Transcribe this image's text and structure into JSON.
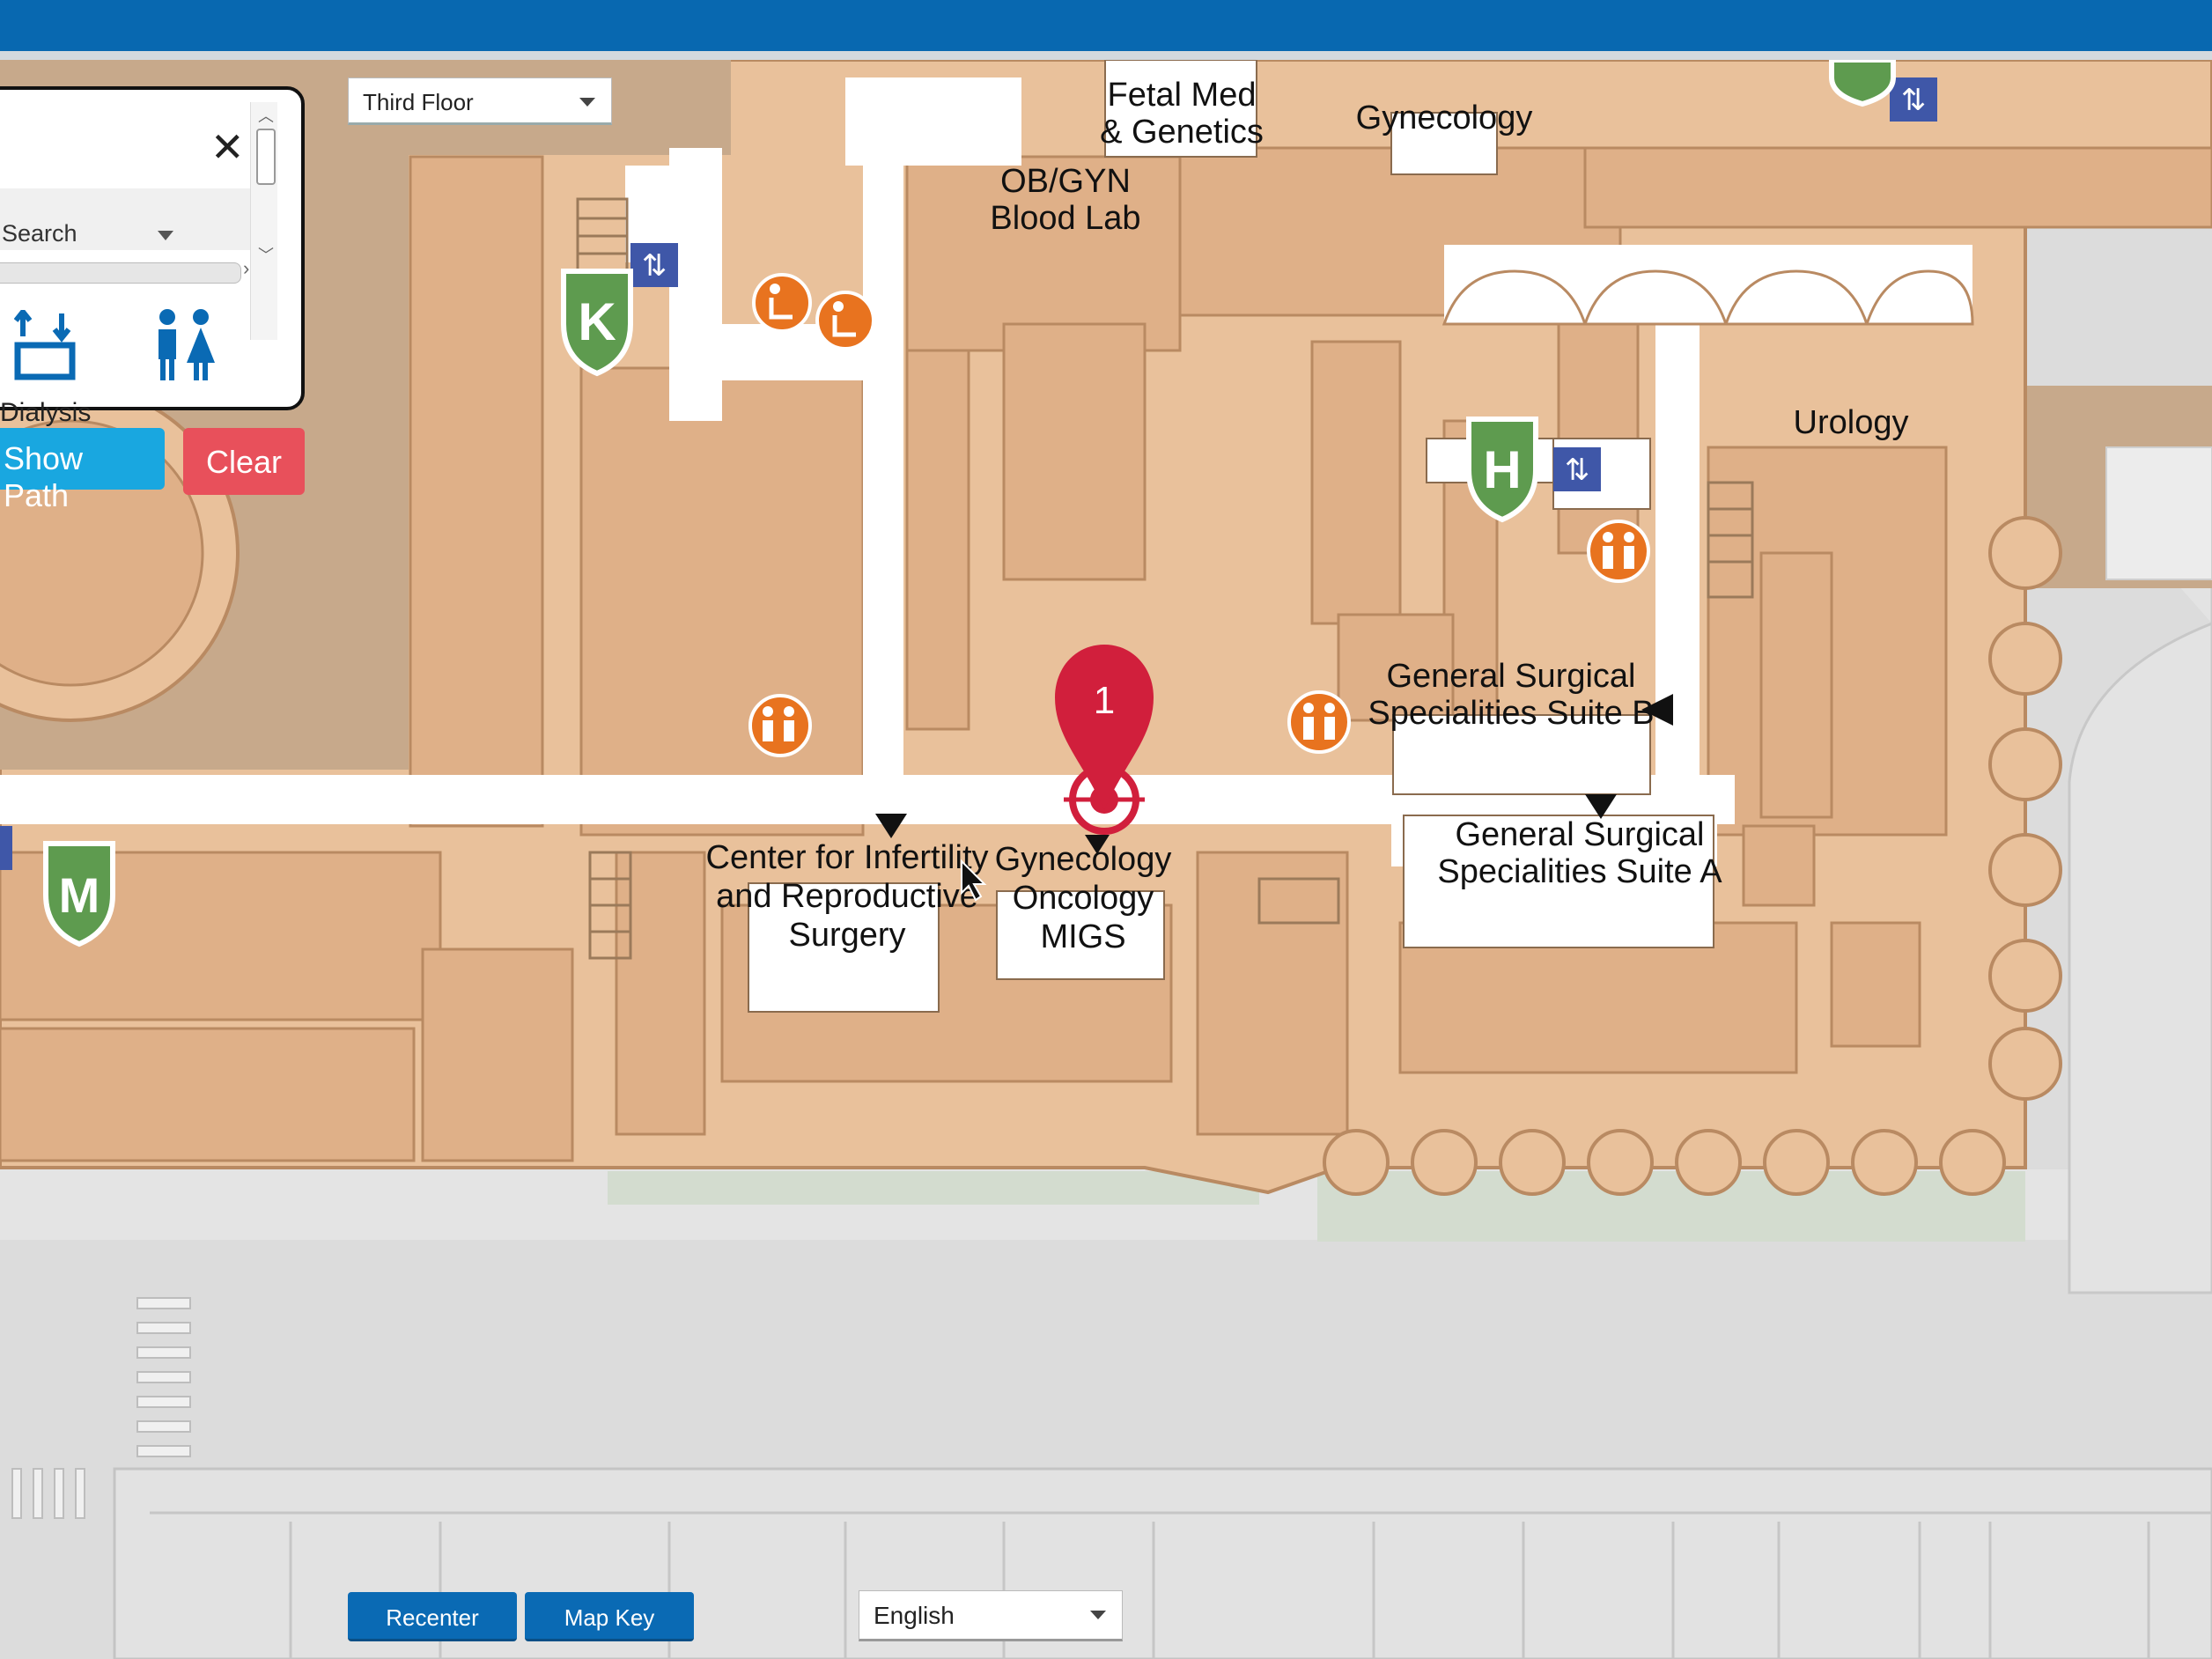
{
  "floor_select": {
    "value": "Third Floor"
  },
  "search_panel": {
    "search_label": "Search",
    "close_symbol": "✕",
    "partial_destination": "Dialysis"
  },
  "buttons": {
    "show_path": "Show Path",
    "clear": "Clear",
    "recenter": "Recenter",
    "map_key": "Map Key"
  },
  "language_select": {
    "value": "English"
  },
  "map": {
    "pin_number": "1",
    "elevator_glyph": "⇅",
    "labels": {
      "fetal_1": "Fetal Med",
      "fetal_2": "& Genetics",
      "gynecology": "Gynecology",
      "obgyn_1": "OB/GYN",
      "obgyn_2": "Blood Lab",
      "urology": "Urology",
      "gss_b_1": "General Surgical",
      "gss_b_2": "Specialities Suite B",
      "gss_a_1": "General Surgical",
      "gss_a_2": "Specialities Suite A",
      "infert_1": "Center for Infertility",
      "infert_2": "and Reproductive",
      "infert_3": "Surgery",
      "gyn_onc_1": "Gynecology",
      "gyn_onc_2": "Oncology",
      "gyn_onc_3": "MIGS"
    },
    "elevator_markers": [
      {
        "letter": "K"
      },
      {
        "letter": "H"
      },
      {
        "letter": "M"
      }
    ]
  },
  "colors": {
    "header": "#0868b0",
    "floor_fill": "#e9c19b",
    "room_fill": "#dfb088",
    "corridor": "#ffffff",
    "ground": "#dcdcdc",
    "pin": "#d11f3c",
    "marker_green": "#5e9b4f",
    "amenity_orange": "#e8731f",
    "show_path_btn": "#19a7e0",
    "clear_btn": "#e8505b"
  }
}
